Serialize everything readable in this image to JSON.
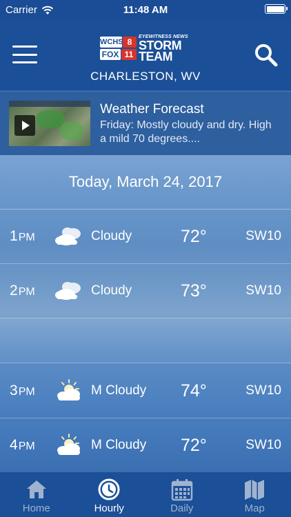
{
  "status_bar": {
    "carrier": "Carrier",
    "time": "11:48 AM"
  },
  "header": {
    "logo": {
      "wchs": "WCHS",
      "eight": "8",
      "fox": "FOX",
      "eleven": "11",
      "eyewitness": "EYEWITNESS NEWS",
      "storm": "STORM",
      "team": "TEAM"
    },
    "location": "CHARLESTON, WV",
    "menu_icon": "hamburger-menu-icon",
    "search_icon": "search-icon"
  },
  "forecast_banner": {
    "title": "Weather Forecast",
    "text": "Friday: Mostly cloudy and dry. High a mild 70 degrees....",
    "play_icon": "play-icon"
  },
  "date_label": "Today, March 24, 2017",
  "hours": [
    {
      "hour": "1",
      "ampm": "PM",
      "condition": "Cloudy",
      "temp": "72°",
      "wind": "SW10",
      "icon": "cloudy-icon"
    },
    {
      "hour": "2",
      "ampm": "PM",
      "condition": "Cloudy",
      "temp": "73°",
      "wind": "SW10",
      "icon": "cloudy-icon"
    },
    {
      "hour": "3",
      "ampm": "PM",
      "condition": "M Cloudy",
      "temp": "74°",
      "wind": "SW10",
      "icon": "mostly-cloudy-icon"
    },
    {
      "hour": "4",
      "ampm": "PM",
      "condition": "M Cloudy",
      "temp": "72°",
      "wind": "SW10",
      "icon": "mostly-cloudy-icon"
    }
  ],
  "tabs": [
    {
      "label": "Home",
      "icon": "home-icon",
      "active": false
    },
    {
      "label": "Hourly",
      "icon": "clock-icon",
      "active": true
    },
    {
      "label": "Daily",
      "icon": "calendar-icon",
      "active": false
    },
    {
      "label": "Map",
      "icon": "map-icon",
      "active": false
    }
  ],
  "colors": {
    "header_bg": "#1b4f97",
    "logo_red": "#d8342b",
    "tab_inactive": "#9fb3cf"
  }
}
